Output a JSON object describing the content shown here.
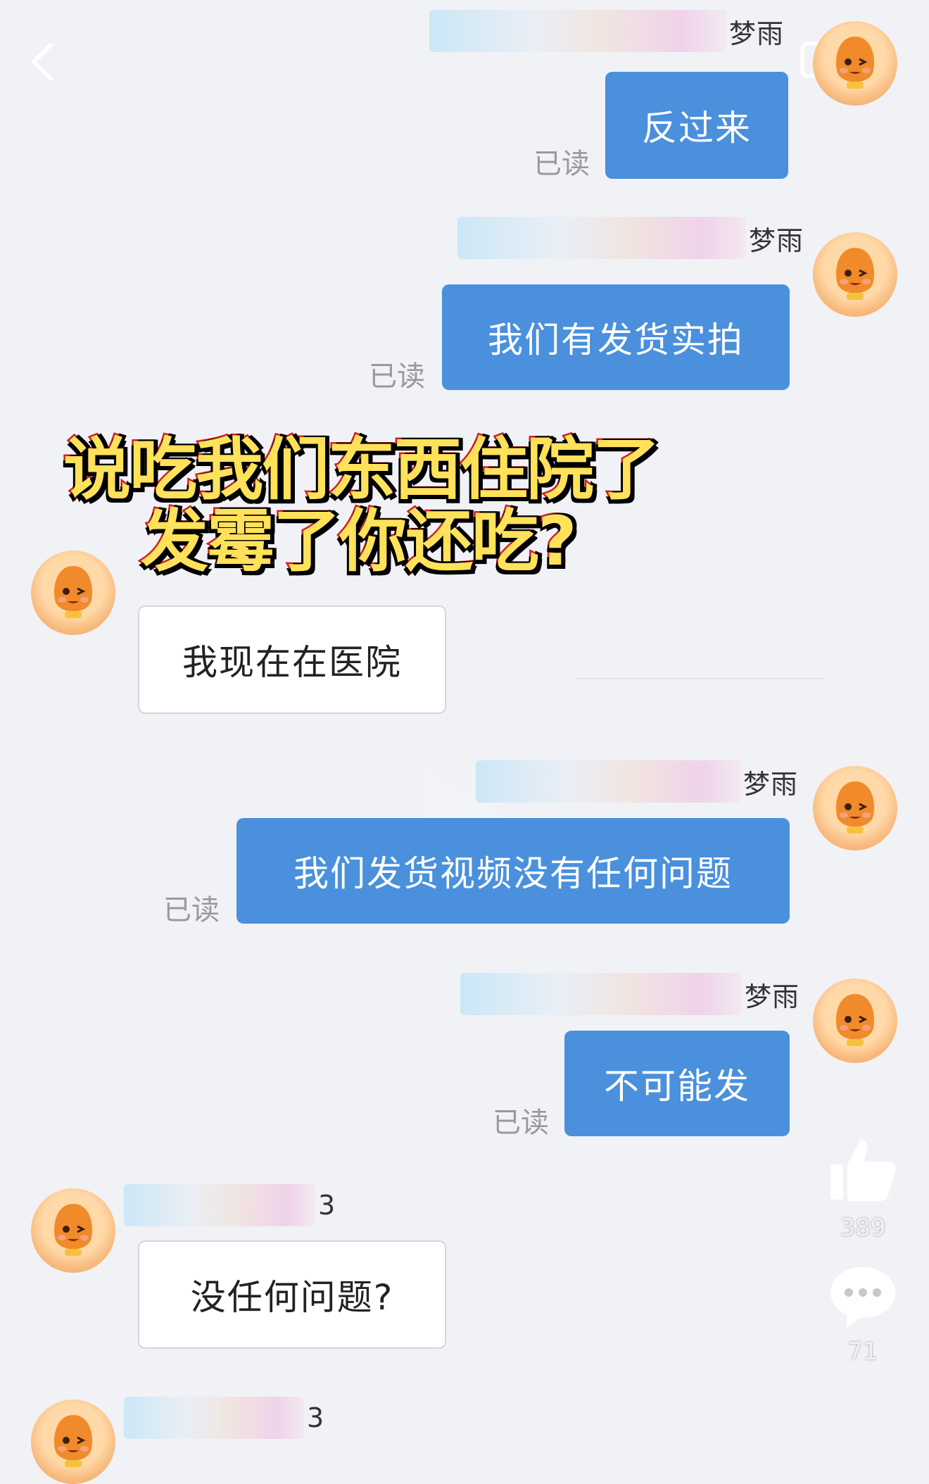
{
  "header": {
    "back_icon": "chevron-left-icon"
  },
  "messages": [
    {
      "side": "out",
      "sender": "梦雨",
      "text": "反过来",
      "status": "已读"
    },
    {
      "side": "out",
      "sender": "梦雨",
      "text": "我们有发货实拍",
      "status": "已读"
    },
    {
      "side": "in",
      "text": "我现在在医院"
    },
    {
      "side": "out",
      "sender": "梦雨",
      "text": "我们发货视频没有任何问题",
      "status": "已读"
    },
    {
      "side": "out",
      "sender": "梦雨",
      "text": "不可能发",
      "status": "已读"
    },
    {
      "side": "in",
      "sender": "3",
      "text": "没任何问题?"
    },
    {
      "side": "in",
      "sender": "3"
    }
  ],
  "caption": {
    "line1": "说吃我们东西住院了",
    "line2": "发霉了你还吃?"
  },
  "actions": {
    "likes": "389",
    "comments": "71"
  },
  "colors": {
    "out_bubble": "#4a90dc",
    "caption_fill": "#ffe25a",
    "caption_stroke": "#d32020"
  }
}
